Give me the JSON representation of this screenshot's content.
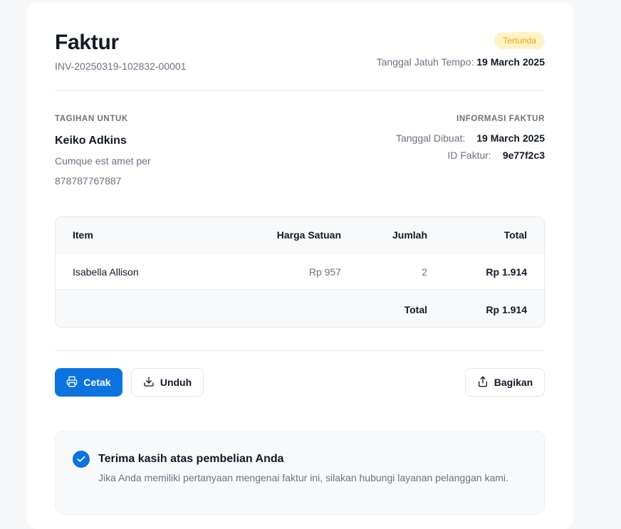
{
  "invoice": {
    "title": "Faktur",
    "number": "INV-20250319-102832-00001",
    "status": "Tertunda",
    "due_label": "Tanggal Jatuh Tempo:",
    "due_date": "19 March 2025"
  },
  "bill_to": {
    "label": "TAGIHAN UNTUK",
    "name": "Keiko Adkins",
    "address": "Cumque est amet per",
    "phone": "878787767887"
  },
  "info": {
    "label": "INFORMASI FAKTUR",
    "created_label": "Tanggal Dibuat:",
    "created_value": "19 March 2025",
    "id_label": "ID Faktur:",
    "id_value": "9e77f2c3"
  },
  "table": {
    "headers": {
      "item": "Item",
      "price": "Harga Satuan",
      "qty": "Jumlah",
      "total": "Total"
    },
    "rows": [
      {
        "item": "Isabella Allison",
        "price": "Rp 957",
        "qty": "2",
        "total": "Rp 1.914"
      }
    ],
    "footer": {
      "label": "Total",
      "value": "Rp 1.914"
    }
  },
  "actions": {
    "print": "Cetak",
    "download": "Unduh",
    "share": "Bagikan"
  },
  "thanks": {
    "title": "Terima kasih atas pembelian Anda",
    "message": "Jika Anda memiliki pertanyaan mengenai faktur ini, silakan hubungi layanan pelanggan kami."
  },
  "colors": {
    "accent": "#0b73e0",
    "status_bg": "#fef3c7",
    "status_text": "#f59e0b"
  },
  "icons": {
    "print": "printer-icon",
    "download": "download-icon",
    "share": "share-icon",
    "check": "check-circle-icon"
  }
}
